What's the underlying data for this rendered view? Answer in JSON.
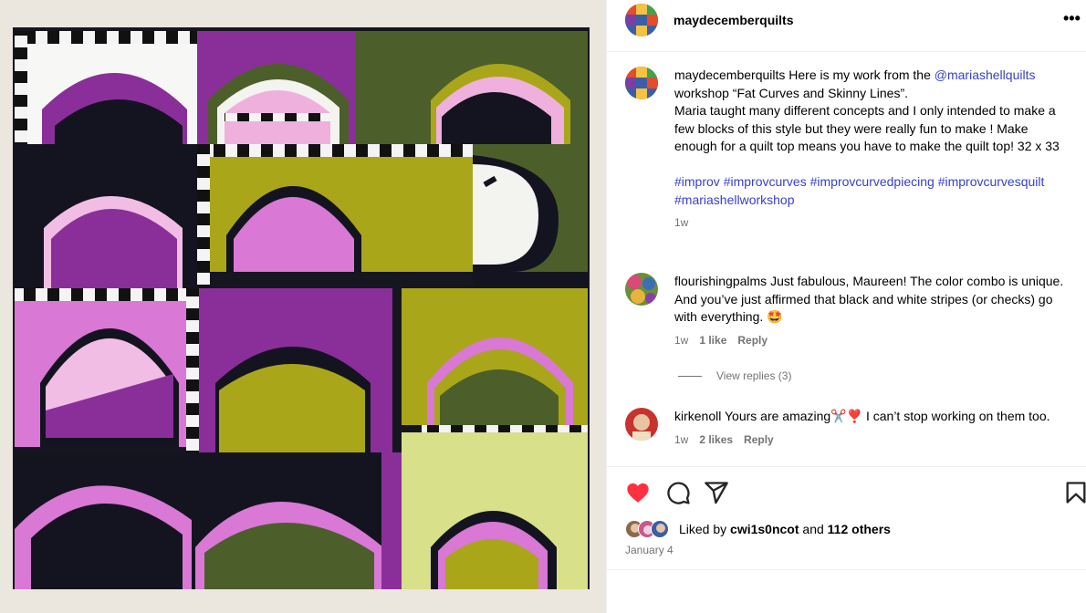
{
  "post": {
    "author": "maydecemberquilts",
    "more_icon": "more-horizontal-icon",
    "more_glyph": "•••"
  },
  "caption": {
    "username": "maydecemberquilts",
    "text_1": "Here is my work from the ",
    "mention": "@mariashellquilts",
    "text_2": "workshop “Fat Curves and Skinny Lines”.",
    "text_3": "Maria taught many different concepts and I only intended to make a few blocks of this style but they were really fun to make ! Make enough for a quilt top means you have to make the quilt top! 32 x 33",
    "hashtags": [
      "#improv",
      "#improvcurves",
      "#improvcurvedpiecing",
      "#improvcurvesquilt",
      "#mariashellworkshop"
    ],
    "time": "1w"
  },
  "comments": [
    {
      "username": "flourishingpalms",
      "text": "Just fabulous, Maureen! The color combo is unique. And you’ve just affirmed that black and white stripes (or checks) go with everything. 🤩",
      "time": "1w",
      "likes": "1 like",
      "reply": "Reply",
      "view_replies": "View replies (3)"
    },
    {
      "username": "kirkenoll",
      "text": "Yours are amazing✂️❣️ I can’t stop working on them too.",
      "time": "1w",
      "likes": "2 likes",
      "reply": "Reply"
    }
  ],
  "actions": {
    "like_icon": "heart-filled-icon",
    "comment_icon": "comment-icon",
    "share_icon": "share-icon",
    "save_icon": "bookmark-icon",
    "liked_by_prefix": "Liked by ",
    "liked_by_user": "cwi1s0ncot",
    "liked_by_and": " and ",
    "liked_by_others": "112 others",
    "date": "January 4"
  },
  "colors": {
    "link": "#3840c9",
    "like_red": "#ff3040",
    "muted": "#737373"
  }
}
